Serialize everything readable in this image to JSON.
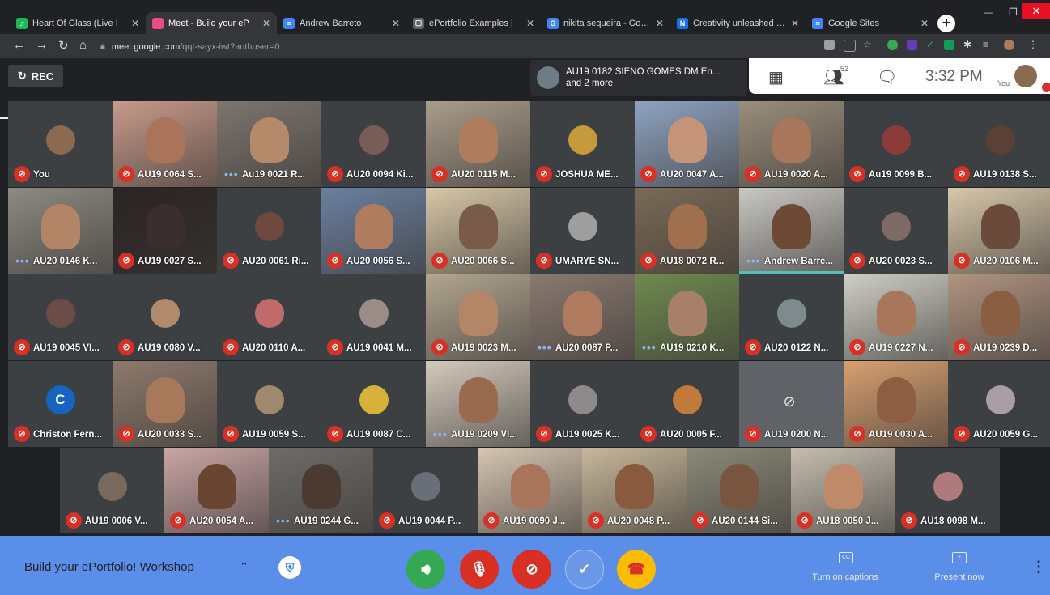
{
  "browser": {
    "tabs": [
      {
        "title": "Heart Of Glass (Live I",
        "favicon_color": "#1db954",
        "favicon_glyph": "♫",
        "active": false
      },
      {
        "title": "Meet - Build your eP",
        "favicon_color": "#ea4c89",
        "favicon_glyph": "",
        "active": true
      },
      {
        "title": "Andrew Barreto",
        "favicon_color": "#4285f4",
        "favicon_glyph": "≡",
        "active": false
      },
      {
        "title": "ePortfolio Examples |",
        "favicon_color": "#5f6368",
        "favicon_glyph": "▢",
        "active": false
      },
      {
        "title": "nikita sequeira - Google",
        "favicon_color": "#4285f4",
        "favicon_glyph": "G",
        "active": false
      },
      {
        "title": "Creativity unleashed - Th",
        "favicon_color": "#1a73e8",
        "favicon_glyph": "N",
        "active": false
      },
      {
        "title": "Google Sites",
        "favicon_color": "#4285f4",
        "favicon_glyph": "≡",
        "active": false
      }
    ],
    "url_domain": "meet.google.com",
    "url_path": "/qqt-sayx-iwt?authuser=0"
  },
  "meet": {
    "rec_label": "REC",
    "presenter_line1": "AU19 0182 SIENO GOMES DM En...",
    "presenter_line2": "and 2 more",
    "participant_count": "52",
    "time": "3:32 PM",
    "you_label": "You",
    "meeting_title": "Build your ePortfolio! Workshop",
    "captions_label": "Turn on captions",
    "present_label": "Present now"
  },
  "participants": [
    {
      "name": "You",
      "tile": "dark",
      "av": "#8b6b50",
      "muted": true
    },
    {
      "name": "AU19 0064 S...",
      "tile": "video",
      "bg": "#c79a8a",
      "skin": "#a9745a",
      "muted": true
    },
    {
      "name": "Au19 0021 R...",
      "tile": "video",
      "bg": "#7d756e",
      "skin": "#b58a6a",
      "muted": false
    },
    {
      "name": "AU20 0094 Ki...",
      "tile": "dark",
      "av": "#7a5c57",
      "muted": true
    },
    {
      "name": "AU20 0115 M...",
      "tile": "video",
      "bg": "#a99c8a",
      "skin": "#b07c5e",
      "muted": true
    },
    {
      "name": "JOSHUA ME...",
      "tile": "dark",
      "av": "#c49a3a",
      "muted": true
    },
    {
      "name": "AU20 0047 A...",
      "tile": "video",
      "bg": "#8ea3c2",
      "skin": "#c59478",
      "muted": true
    },
    {
      "name": "AU19 0020 A...",
      "tile": "video",
      "bg": "#9a8e7c",
      "skin": "#a8765a",
      "muted": true
    },
    {
      "name": "Au19 0099 B...",
      "tile": "dark",
      "av": "#8c3b3b",
      "muted": true
    },
    {
      "name": "AU19 0138 S...",
      "tile": "dark",
      "av": "#5b4036",
      "muted": true
    },
    {
      "name": "AU20 0146 K...",
      "tile": "video",
      "bg": "#8d8a82",
      "skin": "#b48466",
      "muted": false
    },
    {
      "name": "AU19 0027 S...",
      "tile": "video",
      "bg": "#2a2424",
      "skin": "#3a2e2e",
      "muted": true
    },
    {
      "name": "AU20 0061 Ri...",
      "tile": "dark",
      "av": "#6e4a3e",
      "muted": true
    },
    {
      "name": "AU20 0056 S...",
      "tile": "video",
      "bg": "#6a80a0",
      "skin": "#b07c60",
      "muted": true
    },
    {
      "name": "AU20 0066 S...",
      "tile": "video",
      "bg": "#d8c8a8",
      "skin": "#7a5a48",
      "muted": true
    },
    {
      "name": "UMARYE SN...",
      "tile": "dark",
      "av": "#9e9e9e",
      "muted": true
    },
    {
      "name": "AU18 0072 R...",
      "tile": "video",
      "bg": "#7a6a56",
      "skin": "#a0704e",
      "muted": true
    },
    {
      "name": "Andrew Barre...",
      "tile": "video",
      "bg": "#c8c8c4",
      "skin": "#6e4a36",
      "muted": false,
      "speaking": true
    },
    {
      "name": "AU20 0023 S...",
      "tile": "dark",
      "av": "#7d6a66",
      "muted": true
    },
    {
      "name": "AU20 0106 M...",
      "tile": "video",
      "bg": "#d8c8aa",
      "skin": "#6a4a3a",
      "muted": true
    },
    {
      "name": "AU19 0045 VI...",
      "tile": "dark",
      "av": "#6b4c46",
      "muted": true
    },
    {
      "name": "AU19 0080 V...",
      "tile": "dark",
      "av": "#b08a6a",
      "muted": true
    },
    {
      "name": "AU20 0110 A...",
      "tile": "dark",
      "av": "#c06a6a",
      "muted": true
    },
    {
      "name": "AU19 0041 M...",
      "tile": "dark",
      "av": "#9a8c86",
      "muted": true
    },
    {
      "name": "AU19 0023 M...",
      "tile": "video",
      "bg": "#b2a690",
      "skin": "#b28666",
      "muted": true
    },
    {
      "name": "AU20 0087 P...",
      "tile": "video",
      "bg": "#8a7a70",
      "skin": "#b07a5e",
      "muted": false
    },
    {
      "name": "AU19 0210 K...",
      "tile": "video",
      "bg": "#6e8a4e",
      "skin": "#a8806a",
      "muted": false
    },
    {
      "name": "AU20 0122 N...",
      "tile": "dark",
      "av": "#7e8a8e",
      "muted": true
    },
    {
      "name": "AU19 0227 N...",
      "tile": "video",
      "bg": "#cfcfc6",
      "skin": "#a8765a",
      "muted": true
    },
    {
      "name": "AU19 0239 D...",
      "tile": "video",
      "bg": "#b09480",
      "skin": "#8a5e42",
      "muted": true
    },
    {
      "name": "Christon Fern...",
      "tile": "dark",
      "av": "#1565c0",
      "letter": "C",
      "muted": true
    },
    {
      "name": "AU20 0033 S...",
      "tile": "video",
      "bg": "#8e7a6c",
      "skin": "#a8785a",
      "muted": true
    },
    {
      "name": "AU19 0059 S...",
      "tile": "dark",
      "av": "#a08a6c",
      "muted": true
    },
    {
      "name": "AU19 0087 C...",
      "tile": "dark",
      "av": "#d6b23a",
      "muted": true
    },
    {
      "name": "AU19 0209 VI...",
      "tile": "video",
      "bg": "#d4cabc",
      "skin": "#9a6a4e",
      "muted": false
    },
    {
      "name": "AU19 0025 K...",
      "tile": "dark",
      "av": "#8e8a8c",
      "muted": true
    },
    {
      "name": "AU20 0005 F...",
      "tile": "dark",
      "av": "#c07a3a",
      "muted": true
    },
    {
      "name": "AU19 0200 N...",
      "tile": "camoff",
      "muted": true
    },
    {
      "name": "AU19 0030 A...",
      "tile": "video",
      "bg": "#d8a070",
      "skin": "#8e5e44",
      "muted": true
    },
    {
      "name": "AU20 0059 G...",
      "tile": "dark",
      "av": "#a89ea4",
      "muted": true
    },
    {
      "name": "AU19 0006 V...",
      "tile": "dark",
      "av": "#7a6a5e",
      "muted": true
    },
    {
      "name": "AU20 0054 A...",
      "tile": "video",
      "bg": "#caa6a6",
      "skin": "#6a4632",
      "muted": true
    },
    {
      "name": "AU19 0244 G...",
      "tile": "video",
      "bg": "#6e6c6a",
      "skin": "#4a3a32",
      "muted": false
    },
    {
      "name": "AU19 0044 P...",
      "tile": "dark",
      "av": "#6a6e76",
      "muted": true
    },
    {
      "name": "AU19 0090 J...",
      "tile": "video",
      "bg": "#d6c6b2",
      "skin": "#a8745a",
      "muted": true
    },
    {
      "name": "AU20 0048 P...",
      "tile": "video",
      "bg": "#c8b89a",
      "skin": "#8a5a3e",
      "muted": true
    },
    {
      "name": "AU20 0144 Si...",
      "tile": "video",
      "bg": "#8a8a78",
      "skin": "#7a5640",
      "muted": true
    },
    {
      "name": "AU18 0050 J...",
      "tile": "video",
      "bg": "#c6beb0",
      "skin": "#c08a6a",
      "muted": true
    },
    {
      "name": "AU18 0098 M...",
      "tile": "dark",
      "av": "#b07a7a",
      "muted": true
    }
  ],
  "colors": {
    "accent_blue": "#5a8ee8",
    "mute_red": "#d93025",
    "speaker_green": "#34a853",
    "end_yellow": "#fbbc04"
  },
  "icons": {
    "rec": "refresh-icon",
    "mic": "mic-off-icon",
    "camera": "camera-off-icon",
    "people": "people-icon",
    "chat": "chat-icon"
  }
}
